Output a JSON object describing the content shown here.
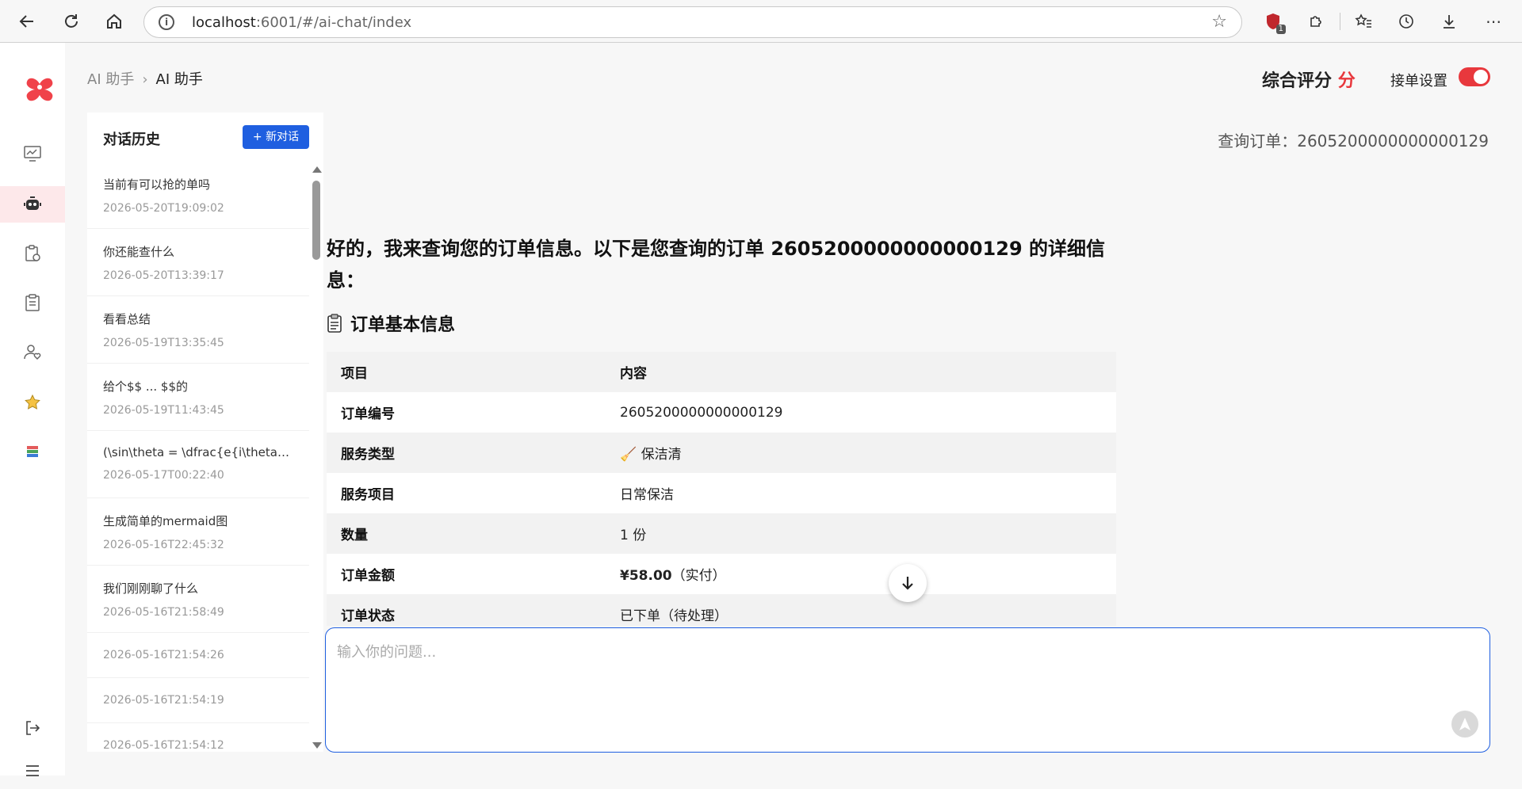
{
  "browser": {
    "url_host": "localhost",
    "url_rest": ":6001/#/ai-chat/index",
    "extension_badge": "1"
  },
  "breadcrumb": {
    "parent": "AI 助手",
    "current": "AI 助手"
  },
  "header": {
    "score_label": "综合评分",
    "score_unit": "分",
    "accept_label": "接单设置",
    "toggle_on": true
  },
  "history": {
    "title": "对话历史",
    "new_button": "+ 新对话",
    "items": [
      {
        "title": "当前有可以抢的单吗",
        "date": "2026-05-20T19:09:02"
      },
      {
        "title": "你还能查什么",
        "date": "2026-05-20T13:39:17"
      },
      {
        "title": "看看总结",
        "date": "2026-05-19T13:35:45"
      },
      {
        "title": "给个$$ ... $$的",
        "date": "2026-05-19T11:43:45"
      },
      {
        "title": "(\\sin\\theta = \\dfrac{e{i\\theta}...",
        "date": "2026-05-17T00:22:40"
      },
      {
        "title": "生成简单的mermaid图",
        "date": "2026-05-16T22:45:32"
      },
      {
        "title": "我们刚刚聊了什么",
        "date": "2026-05-16T21:58:49"
      },
      {
        "title": "",
        "date": "2026-05-16T21:54:26"
      },
      {
        "title": "",
        "date": "2026-05-16T21:54:19"
      },
      {
        "title": "",
        "date": "2026-05-16T21:54:12"
      }
    ]
  },
  "chat": {
    "query_label": "查询订单：2605200000000000129",
    "answer_heading": "好的，我来查询您的订单信息。以下是您查询的订单 2605200000000000129 的详细信息：",
    "section_title": "订单基本信息",
    "table": {
      "headers": [
        "项目",
        "内容"
      ],
      "rows": [
        {
          "key": "订单编号",
          "value": "2605200000000000129"
        },
        {
          "key": "服务类型",
          "value": "🧹 保洁清"
        },
        {
          "key": "服务项目",
          "value": "日常保洁"
        },
        {
          "key": "数量",
          "value": "1 份"
        },
        {
          "key": "订单金额",
          "value_bold": "¥58.00",
          "value_rest": "（实付）"
        },
        {
          "key": "订单状态",
          "value": "已下单（待处理）"
        }
      ]
    },
    "input_placeholder": "输入你的问题..."
  },
  "colors": {
    "accent_red": "#e8383d",
    "primary_blue": "#1f5fe0"
  }
}
